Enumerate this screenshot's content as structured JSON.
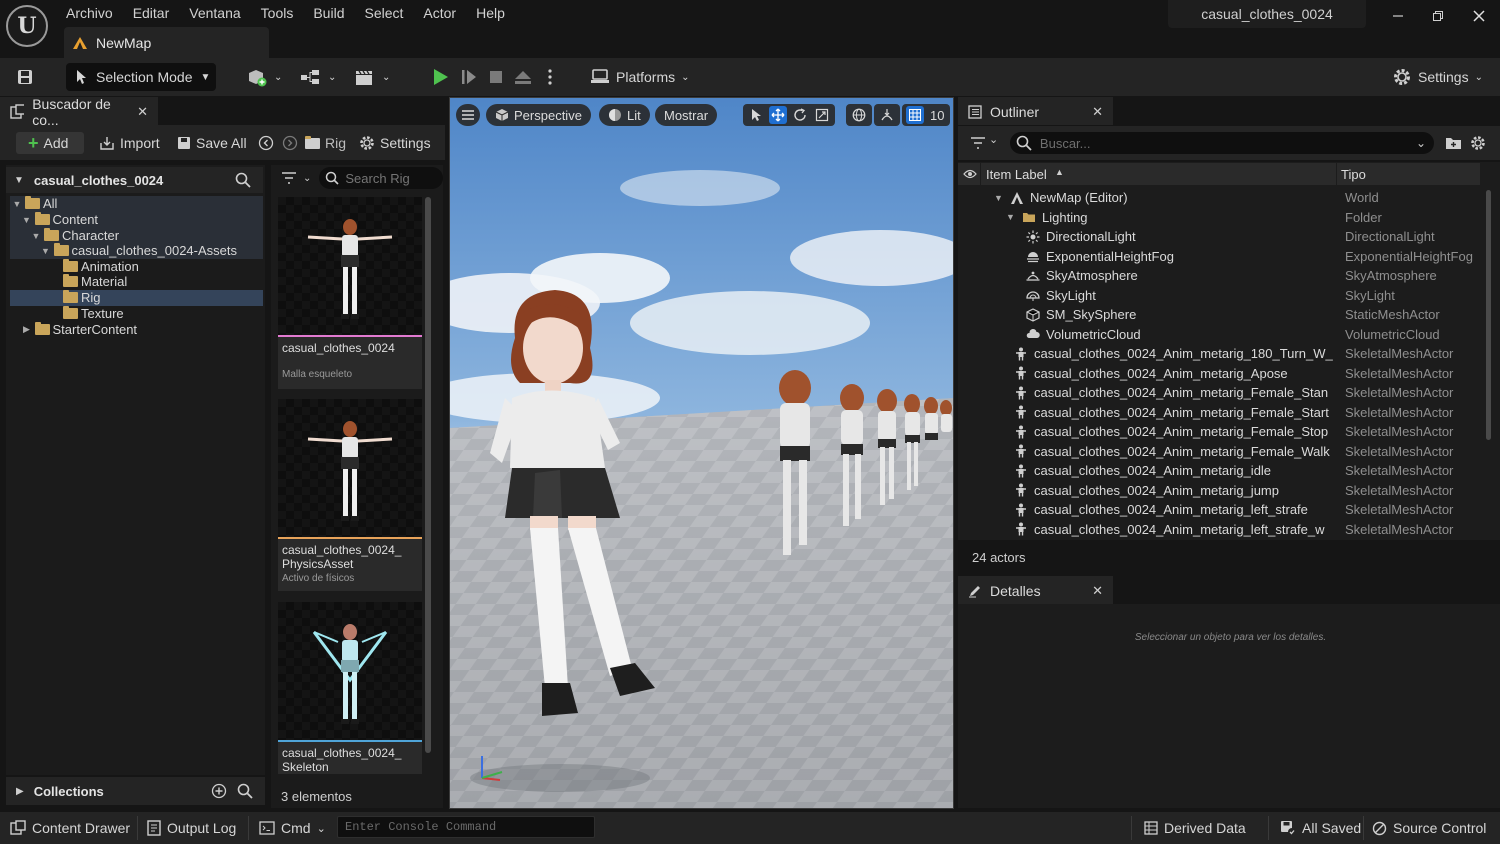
{
  "window": {
    "project_title": "casual_clothes_0024",
    "level_tab": "NewMap",
    "logo_glyph": "U"
  },
  "menu": [
    "Archivo",
    "Editar",
    "Ventana",
    "Tools",
    "Build",
    "Select",
    "Actor",
    "Help"
  ],
  "toolbar": {
    "selection_mode": "Selection Mode",
    "platforms": "Platforms",
    "settings": "Settings"
  },
  "content_browser": {
    "tab_label": "Buscador de co...",
    "add": "Add",
    "import": "Import",
    "save_all": "Save All",
    "path_label": "Rig",
    "settings": "Settings",
    "root_title": "casual_clothes_0024",
    "tree": [
      {
        "label": "All",
        "depth": 0,
        "expanded": true
      },
      {
        "label": "Content",
        "depth": 1,
        "expanded": true
      },
      {
        "label": "Character",
        "depth": 2,
        "expanded": true
      },
      {
        "label": "casual_clothes_0024-Assets",
        "depth": 3,
        "expanded": true
      },
      {
        "label": "Animation",
        "depth": 4
      },
      {
        "label": "Material",
        "depth": 4
      },
      {
        "label": "Rig",
        "depth": 4,
        "selected": true
      },
      {
        "label": "Texture",
        "depth": 4
      },
      {
        "label": "StarterContent",
        "depth": 1,
        "expanded": false
      }
    ],
    "search_placeholder": "Search Rig",
    "assets": [
      {
        "name": "casual_clothes_0024",
        "type": "Malla esqueleto",
        "accent": "#e27ad1"
      },
      {
        "name": "casual_clothes_0024_ PhysicsAsset",
        "type": "Activo de físicos",
        "accent": "#e8a35a"
      },
      {
        "name": "casual_clothes_0024_ Skeleton",
        "type": "",
        "accent": "#4fa4d8"
      }
    ],
    "count": "3 elementos",
    "collections": "Collections"
  },
  "viewport": {
    "perspective": "Perspective",
    "lit": "Lit",
    "show": "Mostrar",
    "grid_snap": "10"
  },
  "outliner": {
    "tab_label": "Outliner",
    "search_placeholder": "Buscar...",
    "col_label": "Item Label",
    "col_type": "Tipo",
    "rows": [
      {
        "label": "NewMap (Editor)",
        "type": "World",
        "indent": 0,
        "icon": "world-icon"
      },
      {
        "label": "Lighting",
        "type": "Folder",
        "indent": 1,
        "icon": "folder-icon"
      },
      {
        "label": "DirectionalLight",
        "type": "DirectionalLight",
        "indent": 2,
        "icon": "sun-icon"
      },
      {
        "label": "ExponentialHeightFog",
        "type": "ExponentialHeightFog",
        "indent": 2,
        "icon": "fog-icon"
      },
      {
        "label": "SkyAtmosphere",
        "type": "SkyAtmosphere",
        "indent": 2,
        "icon": "atmosphere-icon"
      },
      {
        "label": "SkyLight",
        "type": "SkyLight",
        "indent": 2,
        "icon": "skylight-icon"
      },
      {
        "label": "SM_SkySphere",
        "type": "StaticMeshActor",
        "indent": 2,
        "icon": "mesh-icon"
      },
      {
        "label": "VolumetricCloud",
        "type": "VolumetricCloud",
        "indent": 2,
        "icon": "cloud-icon"
      },
      {
        "label": "casual_clothes_0024_Anim_metarig_180_Turn_W_",
        "type": "SkeletalMeshActor",
        "indent": 1,
        "icon": "skeletal-mesh-icon"
      },
      {
        "label": "casual_clothes_0024_Anim_metarig_Apose",
        "type": "SkeletalMeshActor",
        "indent": 1,
        "icon": "skeletal-mesh-icon"
      },
      {
        "label": "casual_clothes_0024_Anim_metarig_Female_Stan",
        "type": "SkeletalMeshActor",
        "indent": 1,
        "icon": "skeletal-mesh-icon"
      },
      {
        "label": "casual_clothes_0024_Anim_metarig_Female_Start",
        "type": "SkeletalMeshActor",
        "indent": 1,
        "icon": "skeletal-mesh-icon"
      },
      {
        "label": "casual_clothes_0024_Anim_metarig_Female_Stop",
        "type": "SkeletalMeshActor",
        "indent": 1,
        "icon": "skeletal-mesh-icon"
      },
      {
        "label": "casual_clothes_0024_Anim_metarig_Female_Walk",
        "type": "SkeletalMeshActor",
        "indent": 1,
        "icon": "skeletal-mesh-icon"
      },
      {
        "label": "casual_clothes_0024_Anim_metarig_idle",
        "type": "SkeletalMeshActor",
        "indent": 1,
        "icon": "skeletal-mesh-icon"
      },
      {
        "label": "casual_clothes_0024_Anim_metarig_jump",
        "type": "SkeletalMeshActor",
        "indent": 1,
        "icon": "skeletal-mesh-icon"
      },
      {
        "label": "casual_clothes_0024_Anim_metarig_left_strafe",
        "type": "SkeletalMeshActor",
        "indent": 1,
        "icon": "skeletal-mesh-icon"
      },
      {
        "label": "casual_clothes_0024_Anim_metarig_left_strafe_w",
        "type": "SkeletalMeshActor",
        "indent": 1,
        "icon": "skeletal-mesh-icon"
      }
    ],
    "count": "24 actors"
  },
  "details": {
    "tab_label": "Detalles",
    "empty_message": "Seleccionar un objeto para ver los detalles."
  },
  "status_bar": {
    "content_drawer": "Content Drawer",
    "output_log": "Output Log",
    "cmd": "Cmd",
    "console_placeholder": "Enter Console Command",
    "derived_data": "Derived Data",
    "all_saved": "All Saved",
    "source_control": "Source Control"
  },
  "colors": {
    "accent_blue": "#1f6fd1",
    "play_green": "#4fc24f",
    "folder_yellow": "#c9a55a",
    "selection": "#34445a"
  }
}
